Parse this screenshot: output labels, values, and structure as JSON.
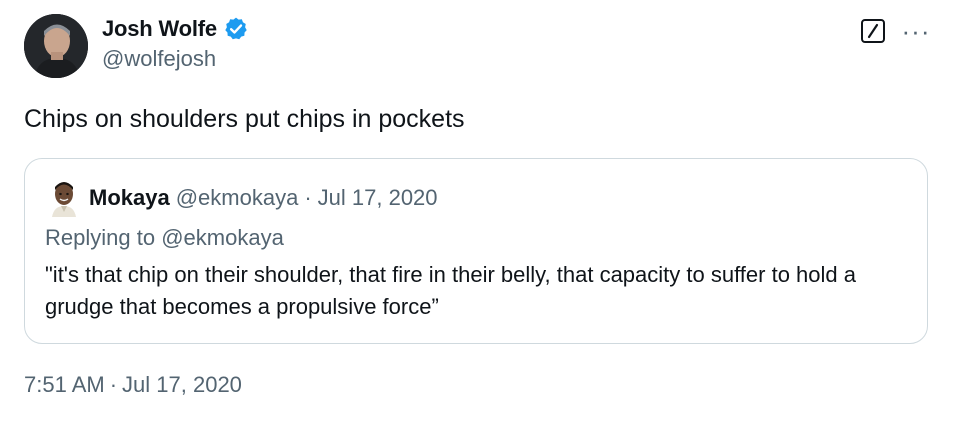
{
  "author": {
    "display_name": "Josh Wolfe",
    "handle": "@wolfejosh",
    "verified": true
  },
  "tweet": {
    "text": "Chips on shoulders put chips in pockets",
    "time": "7:51 AM",
    "separator": "·",
    "date": "Jul 17, 2020"
  },
  "quoted_tweet": {
    "display_name": "Mokaya",
    "handle": "@ekmokaya",
    "separator": "·",
    "date": "Jul 17, 2020",
    "replying_prefix": "Replying to",
    "replying_handle": "@ekmokaya",
    "text": "\"it's that chip on their shoulder, that fire in their belly, that capacity to suffer to hold a grudge that becomes a propulsive force”"
  },
  "actions": {
    "more_label": "···"
  },
  "colors": {
    "primary_text": "#0f1419",
    "secondary_text": "#536471",
    "border": "#cfd9de",
    "verified_blue": "#1d9bf0"
  },
  "icons": {
    "verified": "verified-badge-icon",
    "grok": "grok-icon",
    "more": "more-icon"
  }
}
